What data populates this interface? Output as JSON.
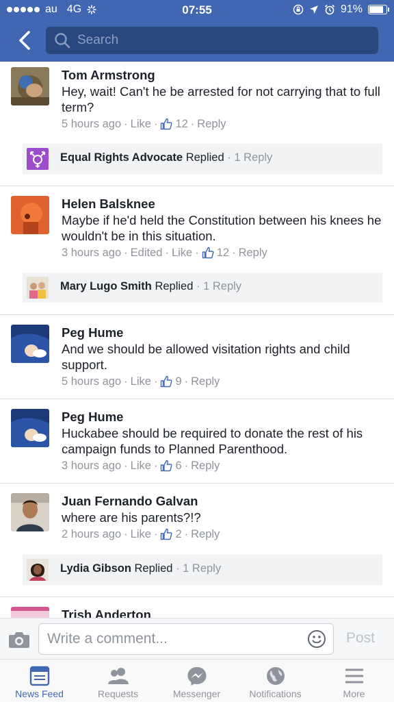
{
  "status_bar": {
    "carrier": "au",
    "network": "4G",
    "time": "07:55",
    "battery": "91%",
    "battery_level": 0.91
  },
  "search": {
    "placeholder": "Search"
  },
  "comments": [
    {
      "name": "Tom Armstrong",
      "text": "Hey, wait! Can't he be arrested for not carrying that to full term?",
      "time": "5 hours ago",
      "like": "Like",
      "likes": "12",
      "reply": "Reply",
      "edited": ""
    },
    {
      "name": "Helen Balsknee",
      "text": "Maybe if he'd held the Constitution between his knees he wouldn't  be in this situation.",
      "time": "3 hours ago",
      "edited": "Edited",
      "like": "Like",
      "likes": "12",
      "reply": "Reply"
    },
    {
      "name": "Peg Hume",
      "text": "And we should be allowed visitation rights and child support.",
      "time": "5 hours ago",
      "like": "Like",
      "likes": "9",
      "reply": "Reply"
    },
    {
      "name": "Peg Hume",
      "text": "Huckabee should be required to donate the rest of his campaign funds to Planned Parenthood.",
      "time": "3 hours ago",
      "like": "Like",
      "likes": "6",
      "reply": "Reply"
    },
    {
      "name": "Juan Fernando Galvan",
      "text": "where are his parents?!?",
      "time": "2 hours ago",
      "like": "Like",
      "likes": "2",
      "reply": "Reply"
    },
    {
      "name": "Trish Anderton"
    }
  ],
  "replies": [
    {
      "name": "Equal Rights Advocate",
      "action": "Replied",
      "count": "1 Reply"
    },
    {
      "name": "Mary Lugo Smith",
      "action": "Replied",
      "count": "1 Reply"
    },
    {
      "name": "Lydia Gibson",
      "action": "Replied",
      "count": "1 Reply"
    }
  ],
  "composer": {
    "placeholder": "Write a comment...",
    "post_label": "Post"
  },
  "tabs": [
    {
      "label": "News Feed",
      "icon": "news-feed-icon",
      "active": true
    },
    {
      "label": "Requests",
      "icon": "friends-icon",
      "active": false
    },
    {
      "label": "Messenger",
      "icon": "messenger-icon",
      "active": false
    },
    {
      "label": "Notifications",
      "icon": "globe-icon",
      "active": false
    },
    {
      "label": "More",
      "icon": "menu-icon",
      "active": false
    }
  ],
  "colors": {
    "brand": "#4267b2",
    "search_bg": "#29487d",
    "meta_gray": "#90949c",
    "reply_bg": "#f2f3f5"
  }
}
